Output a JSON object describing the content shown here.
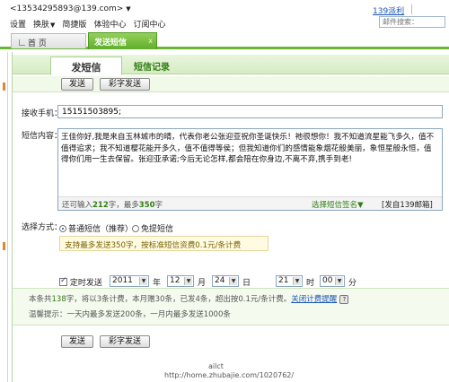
{
  "header": {
    "account": "<13534295893@139.com>",
    "nav": [
      "设置",
      "换肤",
      "简捷版",
      "体验中心",
      "订阅中心"
    ],
    "mail_count": "139派利",
    "search_placeholder": "邮件搜索：",
    "arrow_glyph": "▼"
  },
  "tabs": {
    "home": "首 页",
    "sms": "发送短信",
    "close_glyph": "x"
  },
  "subtabs": {
    "active": "发短信",
    "other": "短信记录"
  },
  "buttons": {
    "send": "发送",
    "color_send": "彩字发送"
  },
  "form": {
    "recipient_label": "接收手机：",
    "recipient_value": "15151503895;",
    "content_label": "短信内容：",
    "content_text": "王佳你好,我是来自玉林城市的晴，代表你老公张迎亚祝你圣诞快乐！祂很想你！我不知道流星能飞多久，值不值得追求；我不知道樱花能开多久，值不值得等侯；但我知道你们的感情能象烟花般美丽，象恒星般永恒，值得你们用一生去保留。张迎亚承诺;今后无论怎样,都会陪在你身边,不离不弃,携手到老!",
    "remaining_prefix": "还可输入",
    "remaining_count": "212",
    "remaining_suffix": "字，最多",
    "max_count": "350",
    "max_unit": "字",
    "signature_select": "选择短信签名▼",
    "signature_tag": "[发自139邮箱]"
  },
  "send_method": {
    "label": "选择方式：",
    "option_normal": "普通短信（推荐）",
    "option_free": "免提短信",
    "info": "支持最多发送350字，按标准短信资费0.1元/条计费"
  },
  "schedule": {
    "label": "定时发送",
    "year": "2011",
    "year_unit": "年",
    "month": "12",
    "month_unit": "月",
    "day": "24",
    "day_unit": "日",
    "hour": "21",
    "hour_unit": "时",
    "minute": "00",
    "minute_unit": "分"
  },
  "stats": {
    "prefix": "本条共",
    "char_count": "138",
    "middle": "字，将以3条计费，本月赠30条，已发4条，超出按0.1元/条计费。",
    "link": "关闭计费提醒",
    "help": "?"
  },
  "tip": "温馨提示：一天内最多发送200条，一月内最多发送1000条",
  "watermark": {
    "line1": "ailct",
    "line2": "http://home.zhubajie.com/1020762/"
  }
}
